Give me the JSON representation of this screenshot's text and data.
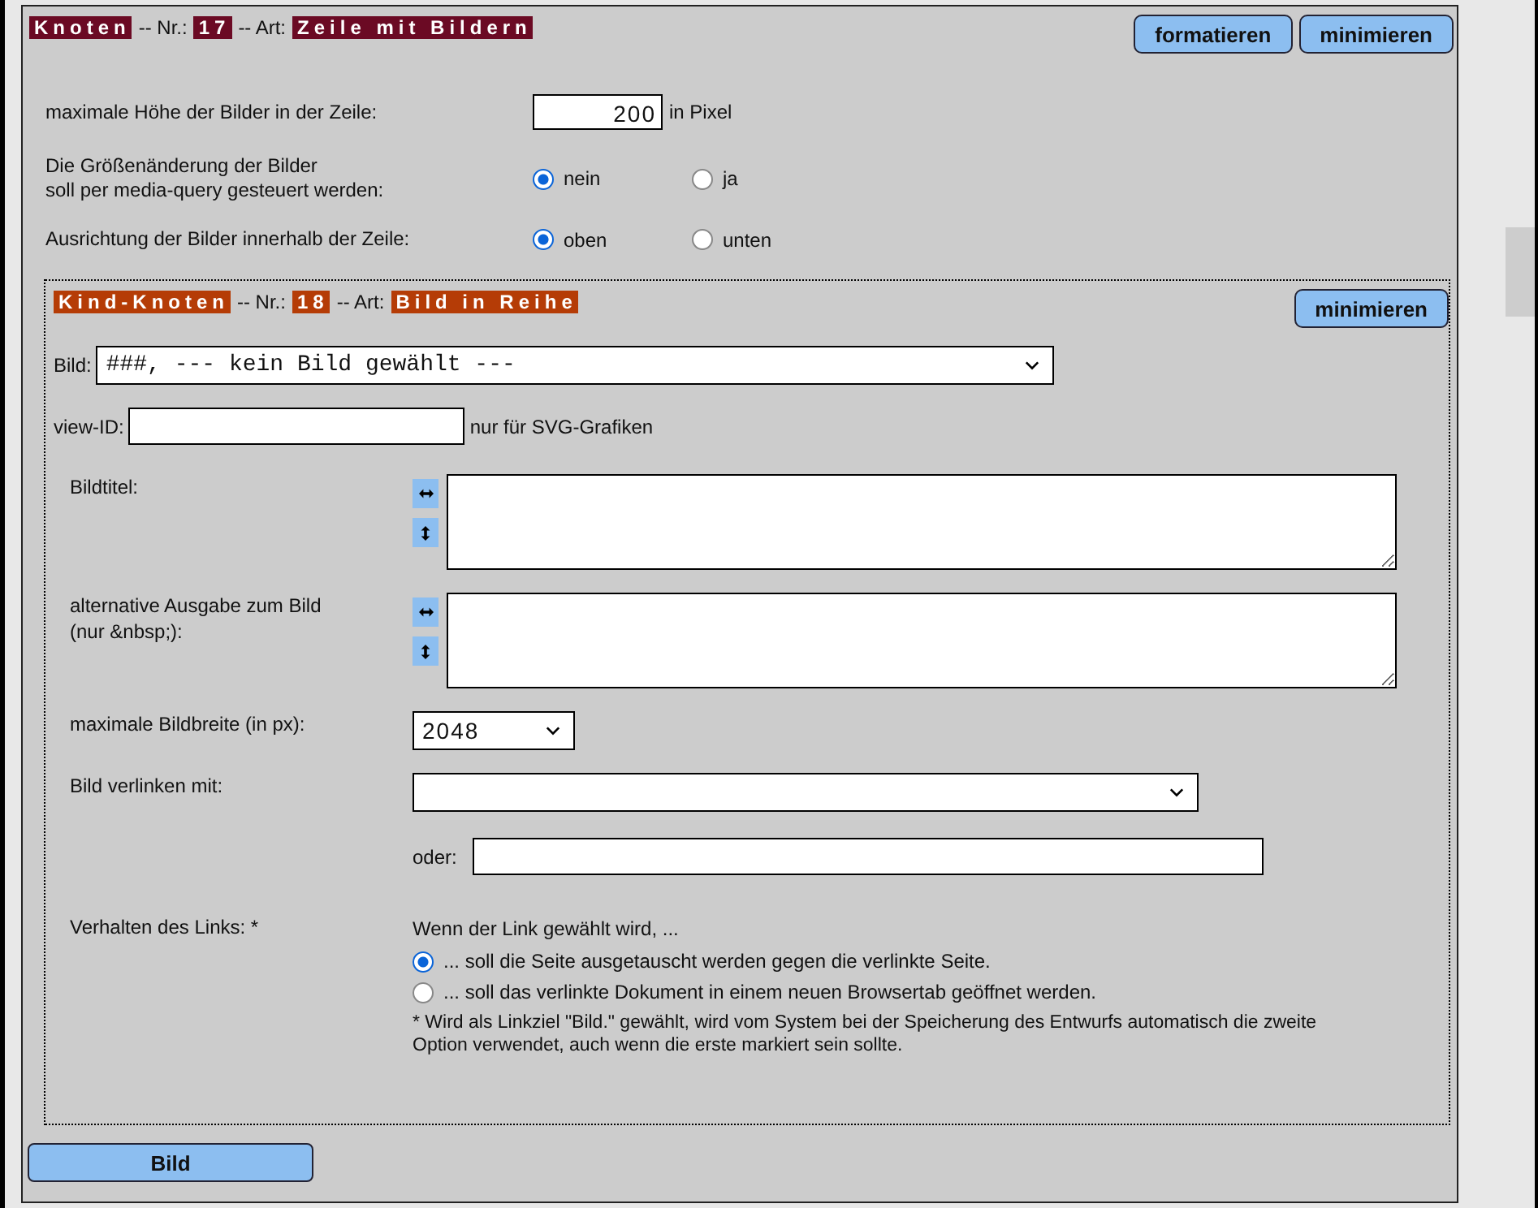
{
  "node": {
    "tag": "Knoten",
    "nr_label": "-- Nr.:",
    "nr": "17",
    "art_label": "-- Art:",
    "art": "Zeile mit Bildern",
    "buttons": [
      "formatieren",
      "minimieren"
    ]
  },
  "settings": [
    {
      "kind": "number",
      "label": "maximale Höhe der Bilder in der Zeile:",
      "value": "200",
      "unit": "in Pixel"
    },
    {
      "kind": "radio",
      "label": "Die Größenänderung der Bilder\nsoll per media-query gesteuert werden:",
      "options": [
        {
          "label": "nein",
          "selected": true
        },
        {
          "label": "ja",
          "selected": false
        }
      ]
    },
    {
      "kind": "radio",
      "label": "Ausrichtung der Bilder innerhalb der Zeile:",
      "options": [
        {
          "label": "oben",
          "selected": true
        },
        {
          "label": "unten",
          "selected": false
        }
      ]
    }
  ],
  "child": {
    "tag": "Kind-Knoten",
    "nr_label": "-- Nr.:",
    "nr": "18",
    "art_label": "-- Art:",
    "art": "Bild in Reihe",
    "button": "minimieren",
    "image": {
      "label": "Bild:",
      "value": "###, --- kein Bild gewählt ---"
    },
    "view_id": {
      "label": "view-ID:",
      "hint": "nur für SVG-Grafiken"
    },
    "textareas": [
      {
        "label": "Bildtitel:"
      },
      {
        "label": "alternative Ausgabe zum Bild\n(nur &nbsp;):"
      }
    ],
    "max_width": {
      "label": "maximale Bildbreite (in px):",
      "value": "2048"
    },
    "link": {
      "label": "Bild verlinken mit:",
      "or_label": "oder:"
    },
    "behavior": {
      "label": "Verhalten des Links: *",
      "intro": "Wenn der Link gewählt wird, ...",
      "options": [
        {
          "label": "... soll die Seite ausgetauscht werden gegen die verlinkte Seite.",
          "selected": true
        },
        {
          "label": "... soll das verlinkte Dokument in einem neuen Browsertab geöffnet werden.",
          "selected": false
        }
      ],
      "note": "* Wird als Linkziel \"Bild.\" gewählt, wird vom System bei der Speicherung des Entwurfs automatisch die zweite\nOption verwendet, auch wenn die erste markiert sein sollte."
    }
  },
  "bottom_button": "Bild"
}
